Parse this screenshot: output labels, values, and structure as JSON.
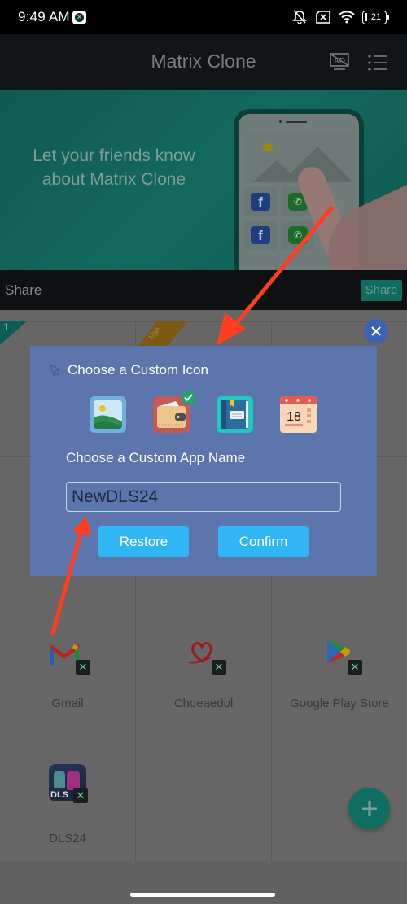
{
  "status_bar": {
    "time": "9:49 AM",
    "battery": "21",
    "icons": [
      "app-notification-icon",
      "mute-icon",
      "no-sim-icon",
      "wifi-icon",
      "battery-icon"
    ]
  },
  "header": {
    "title": "Matrix Clone",
    "actions": [
      "remove-ads-icon",
      "menu-list-icon"
    ]
  },
  "banner": {
    "text": "Let your friends know about Matrix Clone"
  },
  "share_bar": {
    "label": "Share",
    "button_label": "Share"
  },
  "grid": {
    "badges": {
      "number": "1",
      "vip": "VIP"
    },
    "apps": [
      {
        "label": "Gmail",
        "icon": "gmail-icon"
      },
      {
        "label": "Choeaedol",
        "icon": "choeaedol-icon"
      },
      {
        "label": "Google Play Store",
        "icon": "play-store-icon"
      },
      {
        "label": "DLS24",
        "icon": "dls24-icon"
      }
    ]
  },
  "dialog": {
    "icon_section_title": "Choose a Custom Icon",
    "icon_options": [
      {
        "name": "gallery-icon",
        "selected": false
      },
      {
        "name": "wallet-icon",
        "selected": true
      },
      {
        "name": "notebook-icon",
        "selected": false
      },
      {
        "name": "calendar-icon",
        "selected": false,
        "text": "18"
      }
    ],
    "name_section_title": "Choose a Custom App Name",
    "name_value": "NewDLS24",
    "restore_label": "Restore",
    "confirm_label": "Confirm"
  },
  "colors": {
    "dialog_bg": "#5c75ad",
    "button_bg": "#30b6f5",
    "accent": "#0f6e62",
    "annotation": "#ff3d1f"
  }
}
